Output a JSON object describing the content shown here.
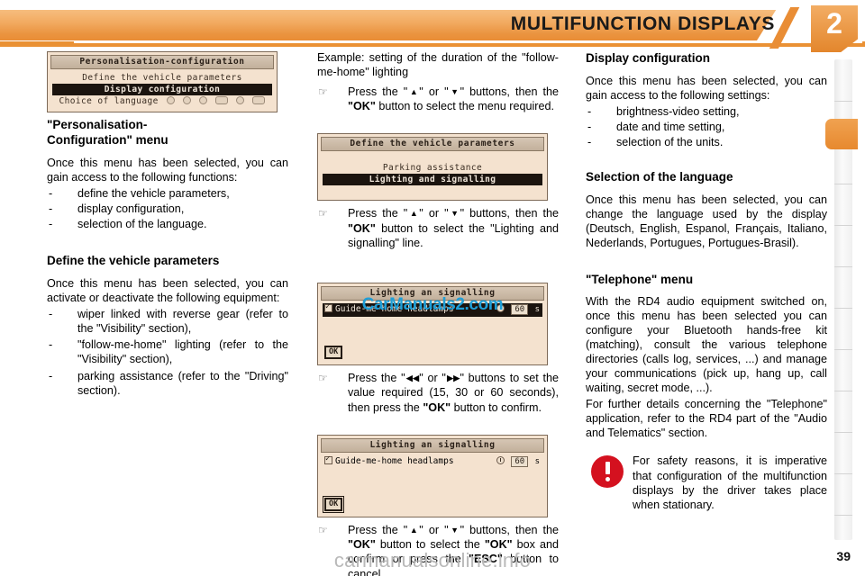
{
  "header": {
    "title": "MULTIFUNCTION DISPLAYS",
    "chapter_number": "2"
  },
  "footer": {
    "page_number": "39",
    "watermark": "carmanualsonline.info"
  },
  "screens": {
    "personalisation": {
      "title": "Personalisation-configuration",
      "rows": [
        {
          "label": "Define the vehicle parameters",
          "selected": false
        },
        {
          "label": "Display configuration",
          "selected": true
        },
        {
          "label": "Choice of language",
          "selected": false,
          "language_icons": 6
        }
      ]
    },
    "vehicle_parameters": {
      "title": "Define the vehicle parameters",
      "rows": [
        {
          "label": "Parking assistance",
          "selected": false
        },
        {
          "label": "Lighting and signalling",
          "selected": true
        }
      ]
    },
    "lighting_selected": {
      "title": "Lighting an signalling",
      "option_label": "Guide-me-home headlamps",
      "checked": true,
      "value": "60",
      "unit": "s",
      "ok_label": "OK",
      "watermark": "CarManuals2.com"
    },
    "lighting_confirm": {
      "title": "Lighting an signalling",
      "option_label": "Guide-me-home headlamps",
      "checked": true,
      "value": "60",
      "unit": "s",
      "ok_label": "OK"
    }
  },
  "left_column": {
    "section1": {
      "heading_line1": "\"Personalisation-",
      "heading_line2": "Configuration\" menu",
      "intro": "Once this menu has been selected, you can gain access to the following functions:",
      "items": [
        "define the vehicle parameters,",
        "display configuration,",
        "selection of the language."
      ]
    },
    "section2": {
      "heading": "Define the vehicle parameters",
      "intro": "Once this menu has been selected, you can activate or deactivate the following equipment:",
      "items": [
        "wiper linked with reverse gear (refer to the \"Visibility\" section),",
        "\"follow-me-home\" lighting (refer to the \"Visibility\" section),",
        "parking assistance (refer to the \"Driving\" section)."
      ]
    }
  },
  "mid_column": {
    "example_intro": "Example: setting of the duration of the \"follow-me-home\" lighting",
    "step1": {
      "pre": "Press the \"",
      "btn_a": "▲",
      "mid": "\" or \"",
      "btn_b": "▼",
      "post": "\" buttons, then the ",
      "ok": "\"OK\"",
      "tail": " button to select the menu required."
    },
    "step2": {
      "pre": "Press the \"",
      "btn_a": "▲",
      "mid": "\" or \"",
      "btn_b": "▼",
      "post": "\" buttons, then the ",
      "ok": "\"OK\"",
      "tail": " button to select the \"Lighting and signalling\" line."
    },
    "step3": {
      "pre": "Press the \"",
      "btn_a": "◀◀",
      "mid": "\" or \"",
      "btn_b": "▶▶",
      "post": "\" buttons to set the value required (15, 30 or 60 seconds), then press the ",
      "ok": "\"OK\"",
      "tail": " button to confirm."
    },
    "step4": {
      "pre": "Press the \"",
      "btn_a": "▲",
      "mid": "\" or \"",
      "btn_b": "▼",
      "post": "\" buttons, then the ",
      "ok": "\"OK\"",
      "mid2": " button to select the ",
      "ok2": "\"OK\"",
      "mid3": " box and confirm or press the ",
      "esc": "\"ESC\"",
      "tail": " button to cancel."
    }
  },
  "right_column": {
    "section1": {
      "heading": "Display configuration",
      "intro": "Once this menu has been selected, you can gain access to the following settings:",
      "items": [
        "brightness-video setting,",
        "date and time setting,",
        "selection of the units."
      ]
    },
    "section2": {
      "heading": "Selection of the language",
      "body": "Once this menu has been selected, you can change the language used by the display (Deutsch, English, Espanol, Français, Italiano, Nederlands, Portugues, Portugues-Brasil)."
    },
    "section3": {
      "heading": "\"Telephone\" menu",
      "body1": "With the RD4 audio equipment switched on, once this menu has been selected you can configure your Bluetooth hands-free kit (matching), consult the various telephone directories (calls log, services, ...) and manage your communications (pick up, hang up, call waiting, secret mode, ...).",
      "body2": "For further details concerning the \"Telephone\" application, refer to the RD4 part of the \"Audio and Telematics\" section."
    },
    "warning": {
      "text": "For safety reasons, it is imperative that configuration of the multifunction displays by the driver takes place when stationary."
    }
  },
  "colors": {
    "accent": "#e98d35",
    "warning": "#d4111f",
    "screen_bg": "#f4e2cf",
    "watermark_blue": "#1f9fd8"
  }
}
